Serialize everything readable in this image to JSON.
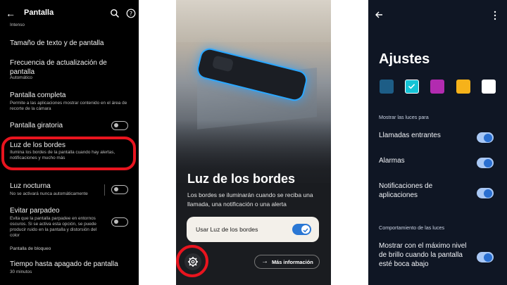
{
  "left_panel": {
    "title": "Pantalla",
    "top_partial": "Intenso",
    "items": [
      {
        "title": "Tamaño de texto y de pantalla"
      },
      {
        "title": "Frecuencia de actualización de pantalla",
        "subtitle": "Automático"
      },
      {
        "title": "Pantalla completa",
        "subtitle": "Permite a las aplicaciones mostrar contenido en el área de recorte de la cámara"
      },
      {
        "title": "Pantalla giratoria"
      },
      {
        "title": "Luz de los bordes",
        "subtitle": "Ilumina los bordes de la pantalla cuando hay alertas, notificaciones y mucho más"
      },
      {
        "title": "Luz nocturna",
        "subtitle": "No se activará nunca automáticamente"
      },
      {
        "title": "Evitar parpadeo",
        "subtitle": "Evita que la pantalla parpadee en entornos oscuros. Si se activa esta opción, se puede producir ruido en la pantalla y distorsión del color"
      }
    ],
    "section_lock": "Pantalla de bloqueo",
    "timeout": {
      "title": "Tiempo hasta apagado de pantalla",
      "subtitle": "30 minutos"
    }
  },
  "middle_panel": {
    "heading": "Luz de los bordes",
    "description": "Los bordes se iluminarán cuando se reciba una llamada, una notificación o una alerta",
    "toggle_label": "Usar Luz de los bordes",
    "more_label": "Más información"
  },
  "right_panel": {
    "title": "Ajustes",
    "swatches": [
      "#1d5d86",
      "#14c3d6",
      "#b22bb0",
      "#f6b21a",
      "#ffffff"
    ],
    "section_show": "Mostrar las luces para",
    "items": [
      {
        "label": "Llamadas entrantes"
      },
      {
        "label": "Alarmas"
      },
      {
        "label": "Notificaciones de aplicaciones"
      }
    ],
    "section_behavior": "Comportamiento de las luces",
    "behavior_item": "Mostrar con el máximo nivel de brillo cuando la pantalla esté boca abajo"
  }
}
